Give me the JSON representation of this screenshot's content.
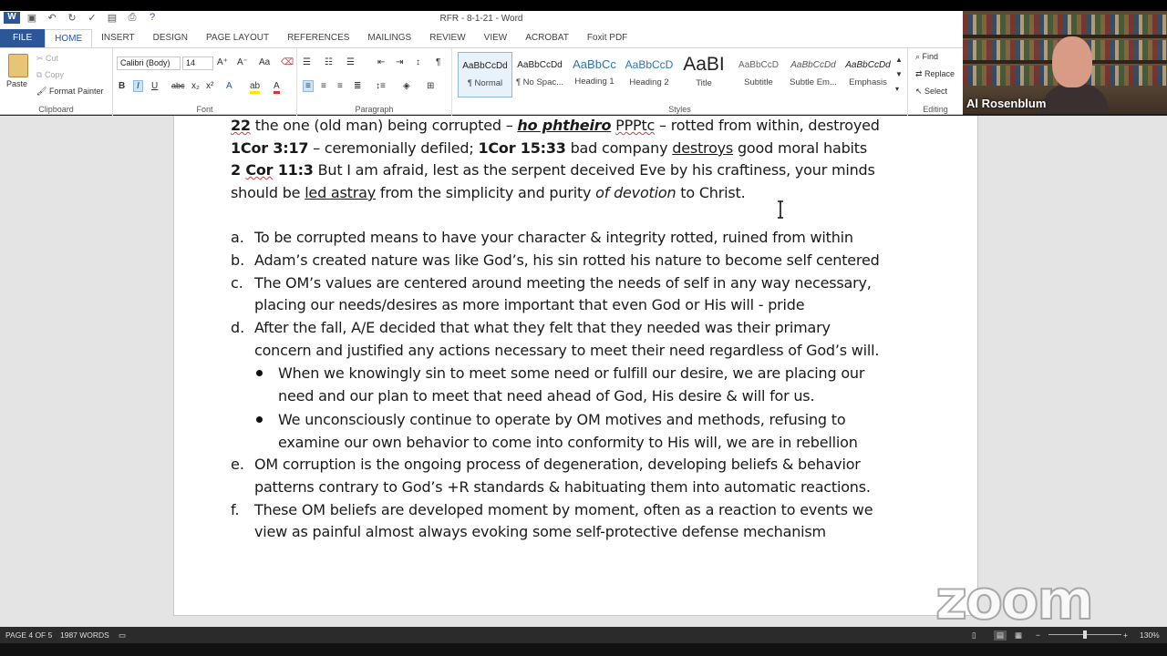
{
  "window": {
    "title": "RFR - 8-1-21 - Word"
  },
  "tabs": [
    {
      "label": "FILE"
    },
    {
      "label": "HOME"
    },
    {
      "label": "INSERT"
    },
    {
      "label": "DESIGN"
    },
    {
      "label": "PAGE LAYOUT"
    },
    {
      "label": "REFERENCES"
    },
    {
      "label": "MAILINGS"
    },
    {
      "label": "REVIEW"
    },
    {
      "label": "VIEW"
    },
    {
      "label": "ACROBAT"
    },
    {
      "label": "Foxit PDF"
    }
  ],
  "clipboard": {
    "paste": "Paste",
    "cut": "Cut",
    "copy": "Copy",
    "format_painter": "Format Painter",
    "label": "Clipboard"
  },
  "font": {
    "name": "Calibri (Body)",
    "size": "14",
    "label": "Font"
  },
  "paragraph": {
    "label": "Paragraph"
  },
  "styles": {
    "label": "Styles",
    "items": [
      {
        "sample": "AaBbCcDd",
        "name": "¶ Normal"
      },
      {
        "sample": "AaBbCcDd",
        "name": "¶ No Spac..."
      },
      {
        "sample": "AaBbCc",
        "name": "Heading 1"
      },
      {
        "sample": "AaBbCcD",
        "name": "Heading 2"
      },
      {
        "sample": "AaBI",
        "name": "Title"
      },
      {
        "sample": "AaBbCcD",
        "name": "Subtitle"
      },
      {
        "sample": "AaBbCcDd",
        "name": "Subtle Em..."
      },
      {
        "sample": "AaBbCcDd",
        "name": "Emphasis"
      }
    ]
  },
  "editing": {
    "find": "Find",
    "replace": "Replace",
    "select": "Select",
    "label": "Editing"
  },
  "video": {
    "speaker": "Al Rosenblum"
  },
  "document": {
    "line1": {
      "ref": "22",
      "t1": " the one (old man) being corrupted – ",
      "greek": "ho phtheiro",
      "t2": " ",
      "pp": "PPPtc",
      "t3": " – rotted from within, destroyed"
    },
    "line2": {
      "ref1": "1Cor 3:17",
      "t1": " – ceremonially defiled; ",
      "ref2": "1Cor 15:33",
      "t2": " bad company ",
      "u": "destroys",
      "t3": " good moral habits"
    },
    "line3": {
      "ref_a": "2 ",
      "ref_b": "Cor",
      "ref_c": " 11:3",
      "t1": " But I am afraid, lest as the serpent deceived Eve by his craftiness, your minds"
    },
    "line4": {
      "t1": "should be ",
      "u": "led astray",
      "t2": " from the simplicity and purity ",
      "i": "of devotion",
      "t3": " to Christ."
    },
    "items": [
      {
        "m": "a.",
        "l1": "To be corrupted means to have your character & integrity rotted, ruined from within"
      },
      {
        "m": "b.",
        "l1": "Adam’s created nature was like God’s, his sin rotted his nature to become self centered"
      },
      {
        "m": "c.",
        "l1": "The OM’s values are centered around meeting the needs of self in any way necessary,",
        "l2": "placing our needs/desires as more important that even God or His will - pride"
      },
      {
        "m": "d.",
        "l1": "After the fall, A/E decided that what they felt that they needed was their primary",
        "l2": "concern and justified any actions necessary to meet their need regardless of God’s will."
      },
      {
        "m": "e.",
        "l1": "OM corruption is the ongoing process of degeneration, developing beliefs & behavior",
        "l2": "patterns contrary to God’s +R standards & habituating them into automatic reactions."
      },
      {
        "m": "f.",
        "l1": "These OM beliefs are developed moment by  moment, often as a reaction to events we",
        "l2": "view as painful almost always evoking some self-protective defense mechanism"
      }
    ],
    "bullets": [
      {
        "l1": "When we knowingly sin to meet some need or fulfill our desire, we are placing our",
        "l2": "need and our plan to meet that need ahead of God, His desire & will for us."
      },
      {
        "l1": "We unconsciously continue to operate by OM motives and methods, refusing to",
        "l2": "examine our own behavior to come into conformity to His will, we are in rebellion"
      }
    ]
  },
  "status": {
    "page": "PAGE 4 OF 5",
    "words": "1987 WORDS",
    "zoom": "130%"
  },
  "watermark": "zoom"
}
